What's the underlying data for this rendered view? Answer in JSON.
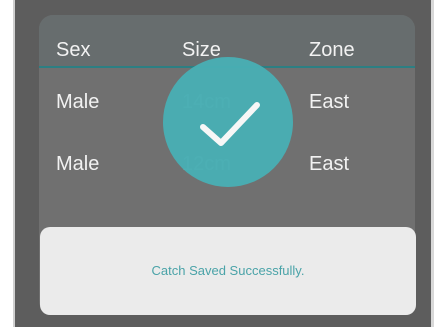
{
  "table": {
    "headers": [
      "Sex",
      "Size",
      "Zone"
    ],
    "rows": [
      [
        "Male",
        "14cm",
        "East"
      ],
      [
        "Male",
        "12cm",
        "East"
      ]
    ]
  },
  "overlay": {
    "icon": "checkmark-icon",
    "color": "#49b0b5"
  },
  "toast": {
    "message": "Catch Saved Successfully."
  }
}
